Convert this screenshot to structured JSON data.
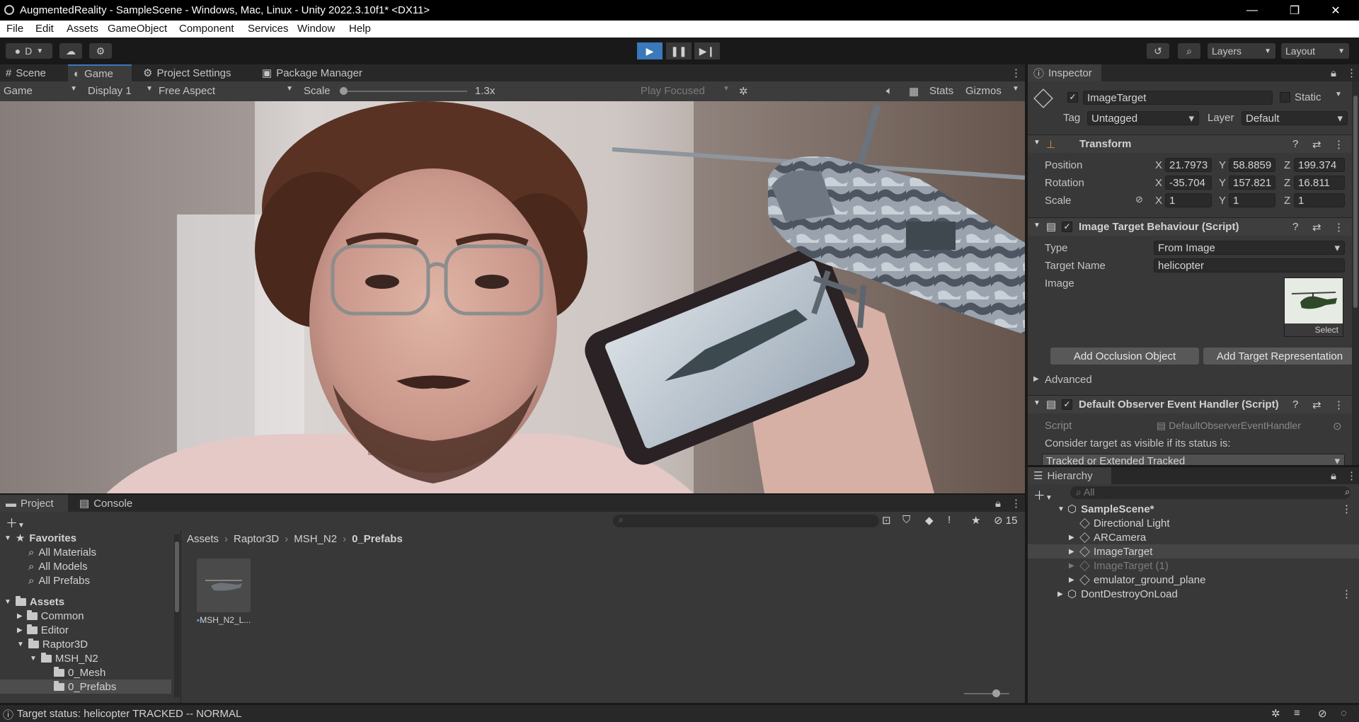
{
  "window": {
    "title": "AugmentedReality - SampleScene - Windows, Mac, Linux - Unity 2022.3.10f1* <DX11>",
    "minimize": "—",
    "restore": "❐",
    "close": "✕"
  },
  "menu": [
    "File",
    "Edit",
    "Assets",
    "GameObject",
    "Component",
    "Services",
    "Window",
    "Help"
  ],
  "toolbar": {
    "account_label": "D",
    "layers_label": "Layers",
    "layout_label": "Layout"
  },
  "top_tabs": {
    "scene": "Scene",
    "game": "Game",
    "project_settings": "Project Settings",
    "package_manager": "Package Manager"
  },
  "game_bar": {
    "view_select": "Game",
    "display": "Display 1",
    "aspect": "Free Aspect",
    "scale_label": "Scale",
    "scale_value": "1.3x",
    "play_mode": "Play Focused",
    "stats": "Stats",
    "gizmos": "Gizmos",
    "scale_fraction": 0.03
  },
  "inspector": {
    "tab_label": "Inspector",
    "object_name": "ImageTarget",
    "static_label": "Static",
    "tag_label": "Tag",
    "tag_value": "Untagged",
    "layer_label": "Layer",
    "layer_value": "Default",
    "transform": {
      "title": "Transform",
      "position_label": "Position",
      "rotation_label": "Rotation",
      "scale_label": "Scale",
      "axis_x": "X",
      "axis_y": "Y",
      "axis_z": "Z",
      "position": [
        "21.7973",
        "58.8859",
        "199.374"
      ],
      "rotation": [
        "-35.704",
        "157.821",
        "16.811"
      ],
      "scale": [
        "1",
        "1",
        "1"
      ]
    },
    "image_target": {
      "title": "Image Target Behaviour (Script)",
      "type_label": "Type",
      "type_value": "From Image",
      "target_name_label": "Target Name",
      "target_name_value": "helicopter",
      "image_label": "Image",
      "select_label": "Select",
      "add_occlusion": "Add Occlusion Object",
      "add_target_rep": "Add Target Representation",
      "advanced": "Advanced"
    },
    "observer": {
      "title": "Default Observer Event Handler (Script)",
      "script_label": "Script",
      "script_value": "DefaultObserverEventHandler",
      "consider_label": "Consider target as visible if its status is:",
      "status_value": "Tracked or Extended Tracked"
    }
  },
  "hierarchy": {
    "tab_label": "Hierarchy",
    "search_placeholder": "All",
    "items": [
      {
        "label": "SampleScene*"
      },
      {
        "label": "Directional Light"
      },
      {
        "label": "ARCamera"
      },
      {
        "label": "ImageTarget"
      },
      {
        "label": "ImageTarget (1)"
      },
      {
        "label": "emulator_ground_plane"
      },
      {
        "label": "DontDestroyOnLoad"
      }
    ]
  },
  "project": {
    "tab_project": "Project",
    "tab_console": "Console",
    "hidden_count": "15",
    "favorites_label": "Favorites",
    "favorites": [
      "All Materials",
      "All Models",
      "All Prefabs"
    ],
    "assets_label": "Assets",
    "tree": [
      "Common",
      "Editor",
      "Raptor3D",
      "MSH_N2",
      "0_Mesh",
      "0_Prefabs"
    ],
    "breadcrumb": [
      "Assets",
      "Raptor3D",
      "MSH_N2",
      "0_Prefabs"
    ],
    "asset_items": [
      {
        "label": "MSH_N2_L..."
      }
    ],
    "thumb_size_fraction": 0.7
  },
  "status": {
    "message": "Target status: helicopter TRACKED -- NORMAL"
  },
  "colors": {
    "accent": "#3a79bb",
    "panel": "#383838",
    "toolbar": "#191919"
  }
}
